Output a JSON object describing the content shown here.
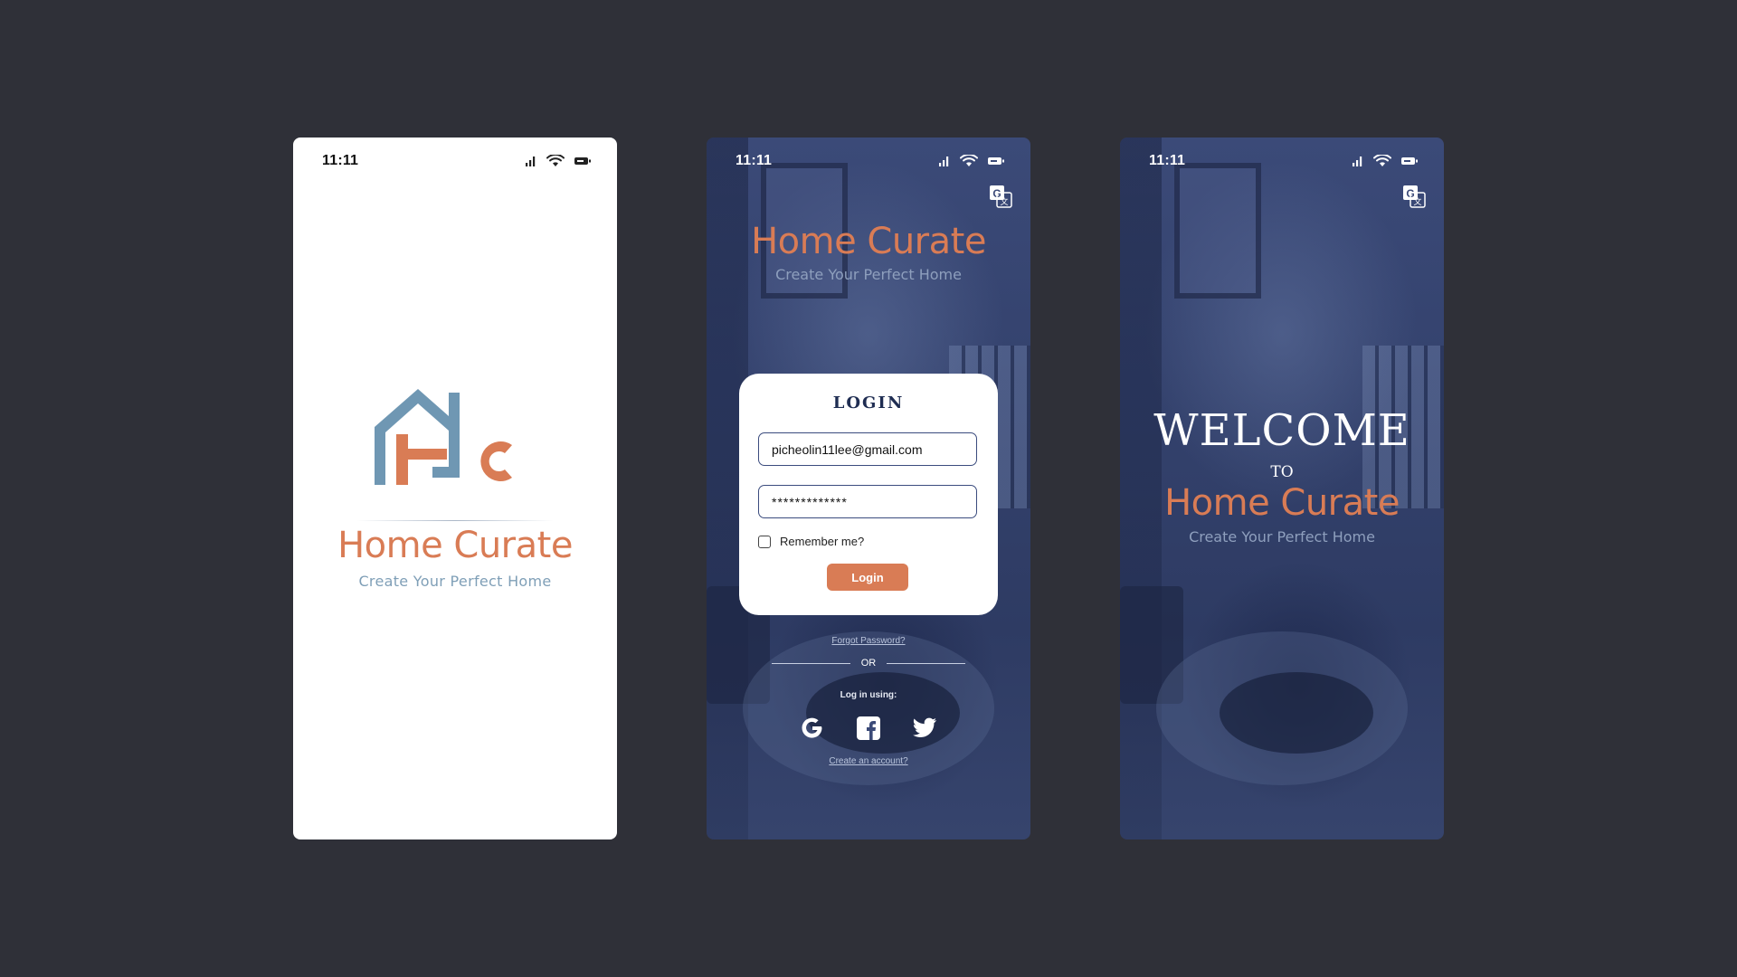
{
  "status_bar": {
    "time": "11:11"
  },
  "brand": {
    "name": "Home Curate",
    "tagline": "Create Your Perfect Home",
    "colors": {
      "orange": "#d97c55",
      "blue": "#6f97b3",
      "navy": "#1f2d52"
    }
  },
  "splash": {
    "logo_icon": "hc-house-logo-icon"
  },
  "login": {
    "title": "LOGIN",
    "email_value": "picheolin11lee@gmail.com",
    "password_value": "*************",
    "remember_label": "Remember me?",
    "login_button": "Login",
    "forgot_password": "Forgot Password?",
    "or_label": "OR",
    "log_in_using": "Log in using:",
    "social_icons": [
      "google-icon",
      "facebook-icon",
      "twitter-icon"
    ],
    "create_account": "Create an account?"
  },
  "welcome": {
    "welcome_text": "WELCOME",
    "to_text": "TO"
  }
}
